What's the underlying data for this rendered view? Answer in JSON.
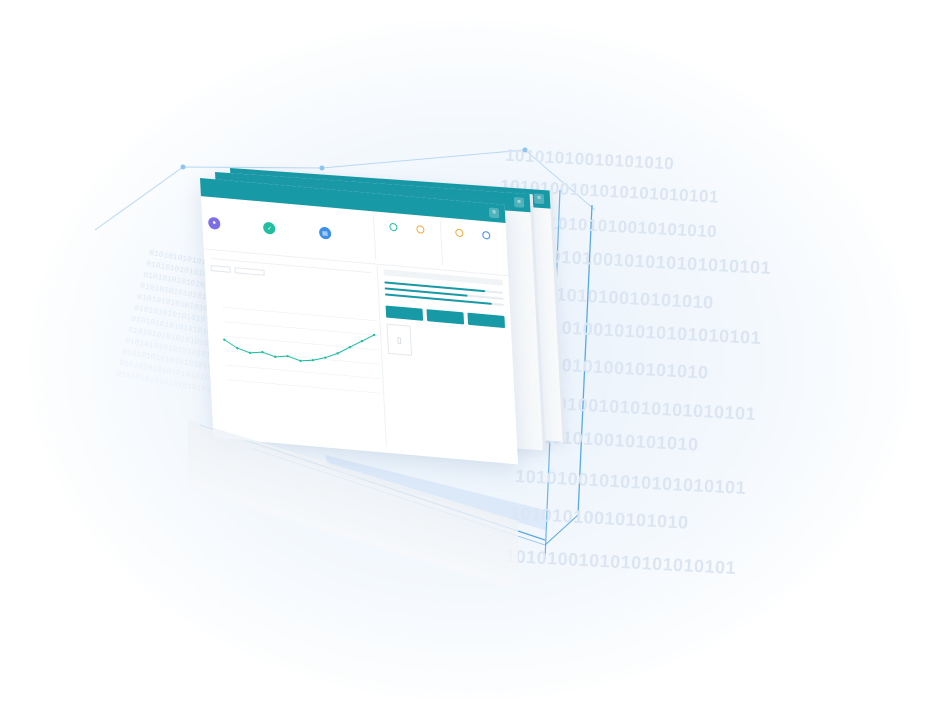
{
  "topbar": {
    "logo": "",
    "menu": [
      "",
      "",
      "",
      "",
      "",
      ""
    ],
    "user": "",
    "menu_icon": "hamburger-icon"
  },
  "stats": [
    {
      "icon": "user-icon",
      "label": "",
      "value": "",
      "color": "#7b6ee6"
    },
    {
      "icon": "check-icon",
      "label": "",
      "value": "",
      "color": "#1fbfa0"
    },
    {
      "icon": "doc-icon",
      "label": "",
      "value": "",
      "color": "#3c8ee8"
    }
  ],
  "mini_panels": [
    {
      "title": "",
      "cells": [
        {
          "v": "",
          "c": "#1fbfa0"
        },
        {
          "v": "",
          "c": "#f2a93b"
        }
      ]
    },
    {
      "title": "",
      "cells": [
        {
          "v": "",
          "c": "#f2a93b"
        },
        {
          "v": "",
          "c": "#3c8ee8"
        }
      ]
    }
  ],
  "chart": {
    "title": "",
    "series_color": "#1fbfa0",
    "values": [
      22,
      18,
      16,
      17,
      15,
      16,
      14,
      15,
      17,
      20,
      24,
      28,
      32
    ]
  },
  "side": {
    "progress": [
      0.85,
      0.7,
      0.9
    ],
    "buttons": [
      "",
      "",
      ""
    ]
  },
  "binary": {
    "right_a": "10101010010101010",
    "right_b": "1010100101010101010101",
    "left": "01010101010101010101010101010101"
  },
  "colors": {
    "accent": "#1799a6",
    "outline": "#5aa9e6",
    "background_glow": "#e8f1fb"
  }
}
